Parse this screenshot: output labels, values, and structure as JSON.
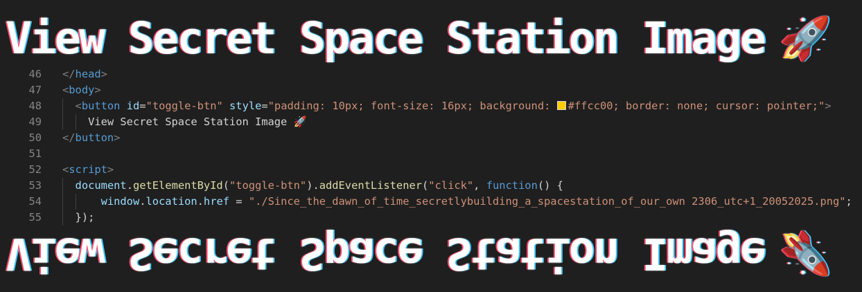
{
  "banner": {
    "text": "View Secret Space Station Image",
    "icon": "🚀",
    "mirrored_text": "View Secret Space Station Image",
    "mirrored_icon": "🚀"
  },
  "editor": {
    "lines": [
      {
        "number": "46"
      },
      {
        "number": "47"
      },
      {
        "number": "48"
      },
      {
        "number": "49"
      },
      {
        "number": "50"
      },
      {
        "number": "51"
      },
      {
        "number": "52"
      },
      {
        "number": "53"
      },
      {
        "number": "54"
      },
      {
        "number": "55"
      }
    ],
    "tokens": {
      "close_head": "head",
      "body": "body",
      "button": "button",
      "id_attr": "id",
      "id_value": "\"toggle-btn\"",
      "style_attr": "style",
      "style_value_a": "\"padding: 10px; font-size: 16px; background: ",
      "style_value_b": "#ffcc00; border: none; cursor: pointer;\"",
      "button_text": "View Secret Space Station Image 🚀",
      "close_button": "button",
      "script": "script",
      "document": "document",
      "get_element": "getElementById",
      "arg_id": "\"toggle-btn\"",
      "add_listener": "addEventListener",
      "arg_event": "\"click\"",
      "function_kw": "function",
      "window": "window",
      "location": "location",
      "href": "href",
      "href_value": "\"./Since_the_dawn_of_time_secretlybuilding_a_spacestation_of_our_own 2306_utc+1_20052025.png\"",
      "close_fn": "});"
    },
    "swatch_color": "#ffcc00"
  }
}
